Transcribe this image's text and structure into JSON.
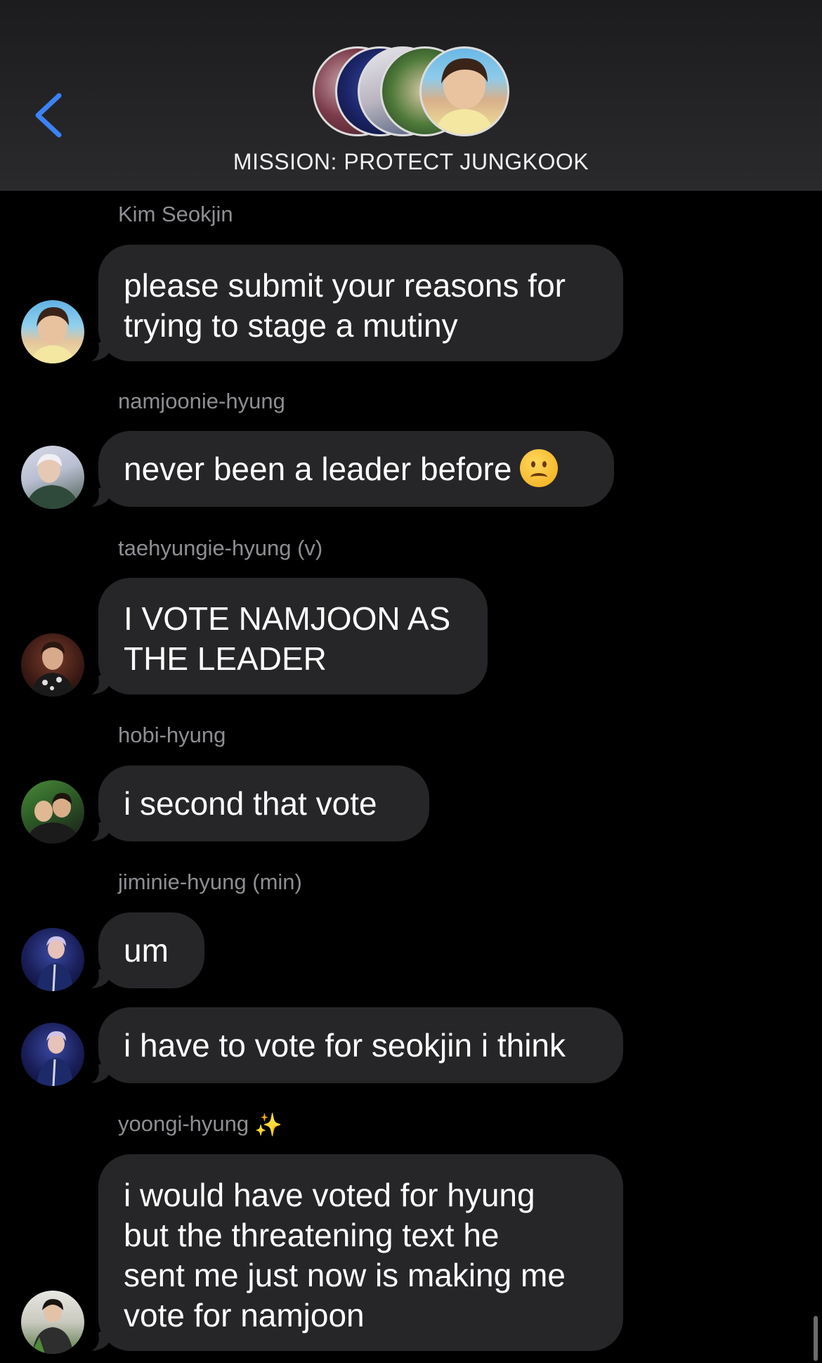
{
  "header": {
    "title": "MISSION: PROTECT JUNGKOOK",
    "back_icon": "chevron-left-icon",
    "accent_color": "#3b82f6",
    "group_avatar_count": 5
  },
  "messages": [
    {
      "sender": "Kim Seokjin",
      "text_lines": [
        "please submit your reasons for",
        "trying to stage a mutiny"
      ]
    },
    {
      "sender": "namjoonie-hyung",
      "text": "never been a leader before",
      "emoji": "frowning-face-emoji"
    },
    {
      "sender": "taehyungie-hyung (v)",
      "text_lines": [
        "I VOTE NAMJOON AS",
        "THE LEADER"
      ]
    },
    {
      "sender": "hobi-hyung",
      "text": "i second that vote"
    },
    {
      "sender": "jiminie-hyung (min)",
      "texts": [
        "um",
        "i have to vote for seokjin i think"
      ]
    },
    {
      "sender": "yoongi-hyung",
      "sender_emoji": "sparkles-emoji",
      "text_lines": [
        "i would have voted for hyung",
        "but the threatening text he",
        "sent me just now is making me",
        "vote for namjoon"
      ]
    }
  ],
  "colors": {
    "background": "#000000",
    "bubble": "#262628",
    "sender_text": "#8e8e93",
    "message_text": "#ffffff"
  }
}
